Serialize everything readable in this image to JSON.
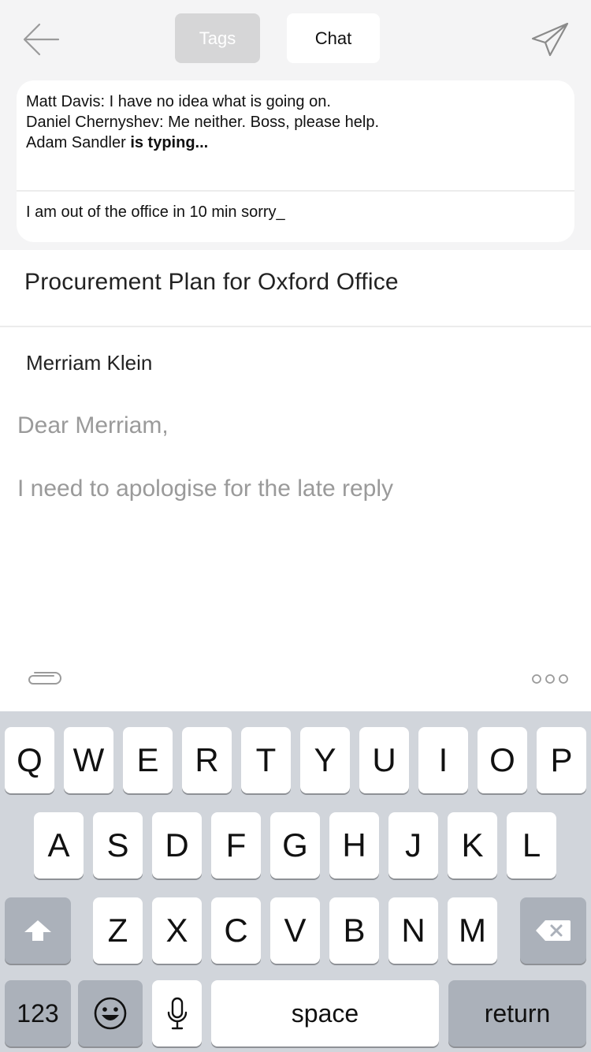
{
  "topbar": {
    "tabs": [
      {
        "label": "Tags",
        "active": false
      },
      {
        "label": "Chat",
        "active": true
      }
    ],
    "back_icon": "arrow-left-icon",
    "send_icon": "paper-plane-icon"
  },
  "chat": {
    "messages": [
      {
        "sender": "Matt Davis",
        "text": "I have no idea what is going on."
      },
      {
        "sender": "Daniel Chernyshev",
        "text": "Me neither. Boss, please help."
      }
    ],
    "typing_user": "Adam Sandler",
    "typing_text": "is typing...",
    "input_value": "I am out of the office in 10 min sorry_"
  },
  "email": {
    "subject": "Procurement Plan for Oxford Office",
    "recipient": "Merriam Klein",
    "greeting": "Dear Merriam,",
    "body": "I need to apologise for the late reply",
    "attach_icon": "paperclip-icon",
    "more_icon": "more-options-icon"
  },
  "keyboard": {
    "row1": [
      "Q",
      "W",
      "E",
      "R",
      "T",
      "Y",
      "U",
      "I",
      "O",
      "P"
    ],
    "row2": [
      "A",
      "S",
      "D",
      "F",
      "G",
      "H",
      "J",
      "K",
      "L"
    ],
    "row3": [
      "Z",
      "X",
      "C",
      "V",
      "B",
      "N",
      "M"
    ],
    "numbers_label": "123",
    "space_label": "space",
    "return_label": "return",
    "colors": {
      "background": "#d1d5db",
      "key": "#ffffff",
      "special_key": "#abb1ba"
    }
  }
}
